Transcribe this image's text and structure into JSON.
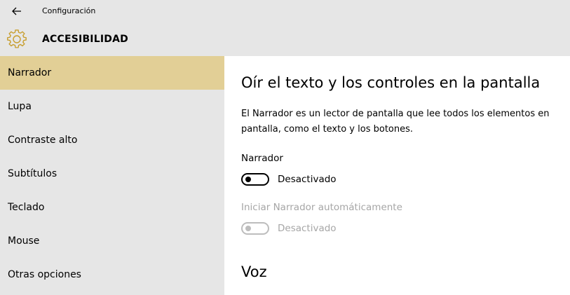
{
  "window": {
    "title": "Configuración"
  },
  "header": {
    "icon": "gear-icon",
    "title": "ACCESIBILIDAD",
    "accent_color": "#c79d2c"
  },
  "sidebar": {
    "selected_color": "#e2cf96",
    "items": [
      {
        "label": "Narrador",
        "selected": true
      },
      {
        "label": "Lupa",
        "selected": false
      },
      {
        "label": "Contraste alto",
        "selected": false
      },
      {
        "label": "Subtítulos",
        "selected": false
      },
      {
        "label": "Teclado",
        "selected": false
      },
      {
        "label": "Mouse",
        "selected": false
      },
      {
        "label": "Otras opciones",
        "selected": false
      }
    ]
  },
  "main": {
    "title": "Oír el texto y los controles en la pantalla",
    "description": "El Narrador es un lector de pantalla que lee todos los elementos en pantalla, como el texto y los botones.",
    "settings": [
      {
        "label": "Narrador",
        "state_text": "Desactivado",
        "on": false,
        "enabled": true
      },
      {
        "label": "Iniciar Narrador automáticamente",
        "state_text": "Desactivado",
        "on": false,
        "enabled": false
      }
    ],
    "next_section": "Voz"
  }
}
